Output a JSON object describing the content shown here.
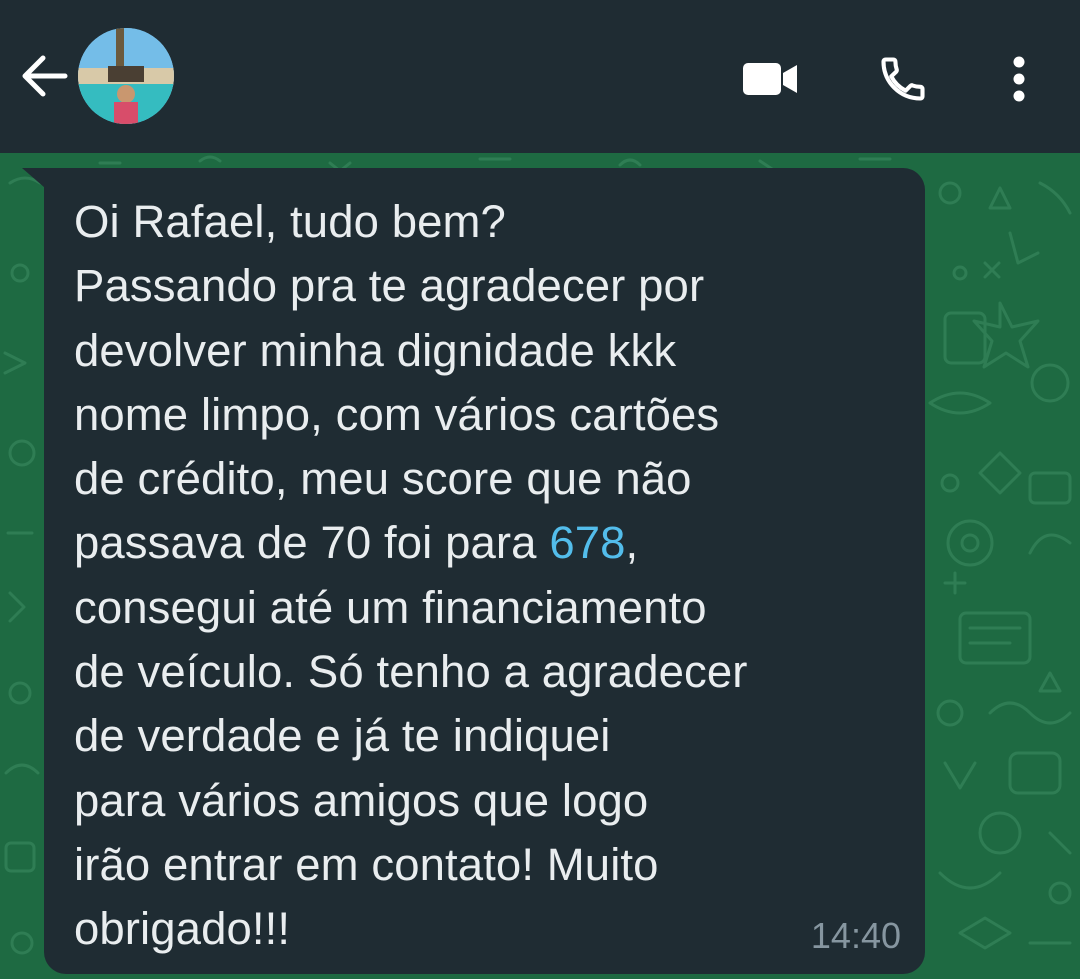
{
  "header": {
    "back_icon": "arrow-left-icon",
    "avatar_icon": "contact-avatar",
    "video_icon": "video-camera-icon",
    "call_icon": "phone-icon",
    "menu_icon": "more-vertical-icon"
  },
  "message": {
    "line_1": "Oi Rafael, tudo bem?",
    "line_2": "Passando pra te agradecer por",
    "line_3": "devolver minha dignidade kkk",
    "line_4": "nome limpo, com vários cartões",
    "line_5": "de crédito, meu score que não",
    "line_6_before": "passava de 70 foi para ",
    "line_6_number": "678",
    "line_6_after": ",",
    "line_7": "consegui até um financiamento",
    "line_8": "de veículo. Só tenho a agradecer",
    "line_9": "de verdade e já te indiquei",
    "line_10": "para vários amigos que logo",
    "line_11": "irão entrar em contato! Muito",
    "line_12": "obrigado!!!",
    "time": "14:40"
  },
  "colors": {
    "header_bg": "#1f2c33",
    "wallpaper_bg": "#1e6a42",
    "bubble_bg": "#1f2c33",
    "text": "#e9edef",
    "link": "#53bdeb",
    "time": "#8696a0"
  }
}
